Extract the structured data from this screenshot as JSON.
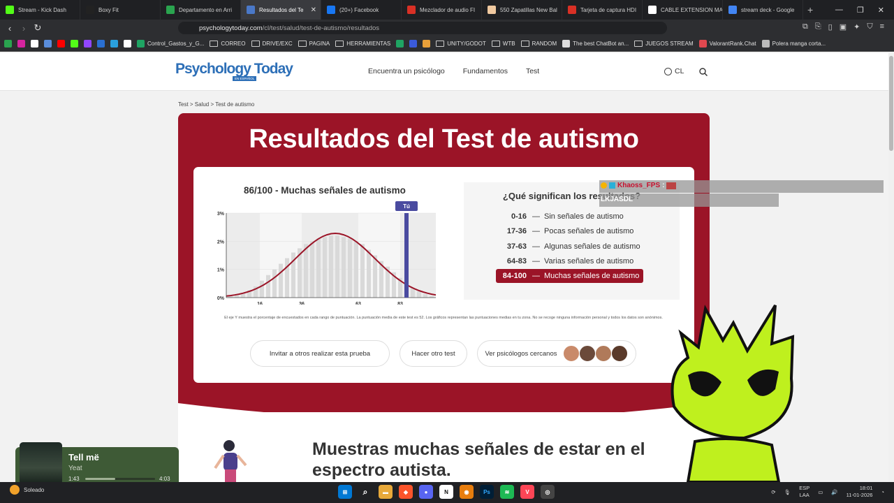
{
  "browser": {
    "tabs": [
      {
        "label": "Stream - Kick Dash",
        "icon": "kick-icon",
        "color": "#53fc18"
      },
      {
        "label": "Boxy Fit",
        "icon": "boxy-icon",
        "color": "#222222"
      },
      {
        "label": "Departamento en Arri",
        "icon": "map-pin-icon",
        "color": "#2aa44f"
      },
      {
        "label": "Resultados del Te",
        "icon": "pt-icon",
        "color": "#4a78c8",
        "active": true
      },
      {
        "label": "(20+) Facebook",
        "icon": "facebook-icon",
        "color": "#1877f2"
      },
      {
        "label": "Mezclador de audio FI",
        "icon": "bookmark-red-icon",
        "color": "#d93025"
      },
      {
        "label": "550 Zapatillas New Bal",
        "icon": "page-icon",
        "color": "#f0c9a0"
      },
      {
        "label": "Tarjeta de captura HDI",
        "icon": "bookmark-red-icon",
        "color": "#d93025"
      },
      {
        "label": "CABLE EXTENSION MA",
        "icon": "mm-icon",
        "color": "#ffffff"
      },
      {
        "label": "stream deck - Google",
        "icon": "google-icon",
        "color": "#4285f4"
      }
    ],
    "url_host": "psychologytoday.com",
    "url_path": "/cl/test/salud/test-de-autismo/resultados",
    "bookmarks": [
      {
        "label": "",
        "type": "sq",
        "color": "#2aa44f"
      },
      {
        "label": "",
        "type": "sq",
        "color": "#d6249f"
      },
      {
        "label": "",
        "type": "sq",
        "color": "#ffffff"
      },
      {
        "label": "",
        "type": "sq",
        "color": "#5a8ddb"
      },
      {
        "label": "",
        "type": "sq",
        "color": "#ff0000"
      },
      {
        "label": "",
        "type": "sq",
        "color": "#53fc18"
      },
      {
        "label": "",
        "type": "sq",
        "color": "#9146ff"
      },
      {
        "label": "",
        "type": "sq",
        "color": "#2a6fd1"
      },
      {
        "label": "",
        "type": "sq",
        "color": "#2aa1de"
      },
      {
        "label": "",
        "type": "sq",
        "color": "#ffffff"
      },
      {
        "label": "Control_Gastos_y_G...",
        "type": "sq",
        "color": "#1fa463"
      },
      {
        "label": "CORREO",
        "type": "fold"
      },
      {
        "label": "DRIVE/EXC",
        "type": "fold"
      },
      {
        "label": "PAGINA",
        "type": "fold"
      },
      {
        "label": "HERRAMIENTAS",
        "type": "fold"
      },
      {
        "label": "",
        "type": "sq",
        "color": "#1fa463"
      },
      {
        "label": "",
        "type": "sq",
        "color": "#3b5bdb"
      },
      {
        "label": "",
        "type": "sq",
        "color": "#e8a03a"
      },
      {
        "label": "UNITY/GODOT",
        "type": "fold"
      },
      {
        "label": "WTB",
        "type": "fold"
      },
      {
        "label": "RANDOM",
        "type": "fold"
      },
      {
        "label": "The best ChatBot an...",
        "type": "sq",
        "color": "#dddddd"
      },
      {
        "label": "JUEGOS STREAM",
        "type": "fold"
      },
      {
        "label": "ValorantRank.Chat",
        "type": "sq",
        "color": "#e0484f"
      },
      {
        "label": "Polera manga corta...",
        "type": "sq",
        "color": "#bbbbbb"
      }
    ]
  },
  "site": {
    "logo": "Psychology Today",
    "logo_sub": "EN ESPAÑOL",
    "nav": [
      "Encuentra un psicólogo",
      "Fundamentos",
      "Test"
    ],
    "country": "CL"
  },
  "page": {
    "breadcrumb": "Test > Salud > Test de autismo",
    "title": "Resultados del Test de autismo",
    "score_title": "86/100 - Muchas señales de autismo",
    "you_label": "Tú",
    "caption": "El eje Y muestra el porcentaje de encuestados en cada rango de puntuación. La puntuación media de este test es 52. Los gráficos representan las puntuaciones medias en tu zona. No se recoge ninguna información personal y todos los datos son anónimos.",
    "meaning_title": "¿Qué significan los resultados?",
    "ranges": [
      {
        "range": "0-16",
        "label": "Sin señales de autismo"
      },
      {
        "range": "17-36",
        "label": "Pocas señales de autismo"
      },
      {
        "range": "37-63",
        "label": "Algunas señales de autismo"
      },
      {
        "range": "64-83",
        "label": "Varias señales de autismo"
      },
      {
        "range": "84-100",
        "label": "Muchas señales de autismo",
        "highlight": true
      }
    ],
    "buttons": {
      "invite": "Invitar a otros realizar esta prueba",
      "retake": "Hacer otro test",
      "nearby": "Ver psicólogos cercanos"
    },
    "subhead_line1": "Muestras muchas señales de estar en el",
    "subhead_line2": "espectro autista.",
    "accent": "#9b1427"
  },
  "chart_data": {
    "type": "bar",
    "ylim": [
      0,
      3
    ],
    "y_ticks": [
      "3%",
      "2%",
      "1%",
      "0%"
    ],
    "x_ticks": [
      "16",
      "36",
      "63",
      "83"
    ],
    "user_score": 86,
    "mean_score": 52,
    "x": [
      2,
      5,
      8,
      11,
      14,
      17,
      20,
      23,
      26,
      29,
      32,
      35,
      38,
      41,
      44,
      47,
      50,
      53,
      56,
      59,
      62,
      65,
      68,
      71,
      74,
      77,
      80,
      83,
      86,
      89,
      92,
      95,
      98
    ],
    "values": [
      0.05,
      0.08,
      0.15,
      0.25,
      0.4,
      0.6,
      0.8,
      1.0,
      1.2,
      1.4,
      1.6,
      1.75,
      1.9,
      2.0,
      2.1,
      2.15,
      2.2,
      2.2,
      2.15,
      2.1,
      2.0,
      1.9,
      1.7,
      1.5,
      1.3,
      1.1,
      0.9,
      0.7,
      0.5,
      0.35,
      0.22,
      0.12,
      0.05
    ],
    "curve_peak": 2.28
  },
  "overlay": {
    "chat_user": "Khaoss_FPS",
    "chat_message": "LKJASDL",
    "music_title": "Tell më",
    "music_artist": "Yeat",
    "music_elapsed": "1:43",
    "music_total": "4:03",
    "music_progress": 0.43
  },
  "taskbar": {
    "weather": "Soleado",
    "weather_temp": "",
    "lang": "ESP",
    "lang2": "LAA",
    "time": "18:01",
    "date": "11-01-2026"
  }
}
